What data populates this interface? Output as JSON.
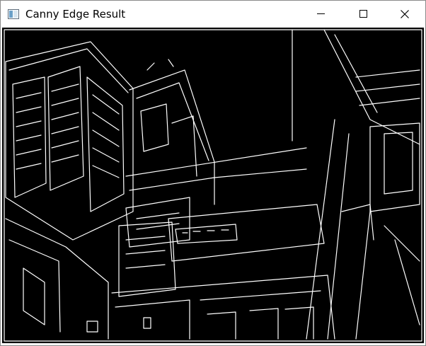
{
  "window": {
    "title": "Canny Edge Result",
    "controls": {
      "minimize_icon": "minimize-icon",
      "maximize_icon": "maximize-icon",
      "close_icon": "close-icon"
    }
  },
  "image": {
    "kind": "binary edge map",
    "background_color": "#000000",
    "edge_color": "#ffffff"
  }
}
